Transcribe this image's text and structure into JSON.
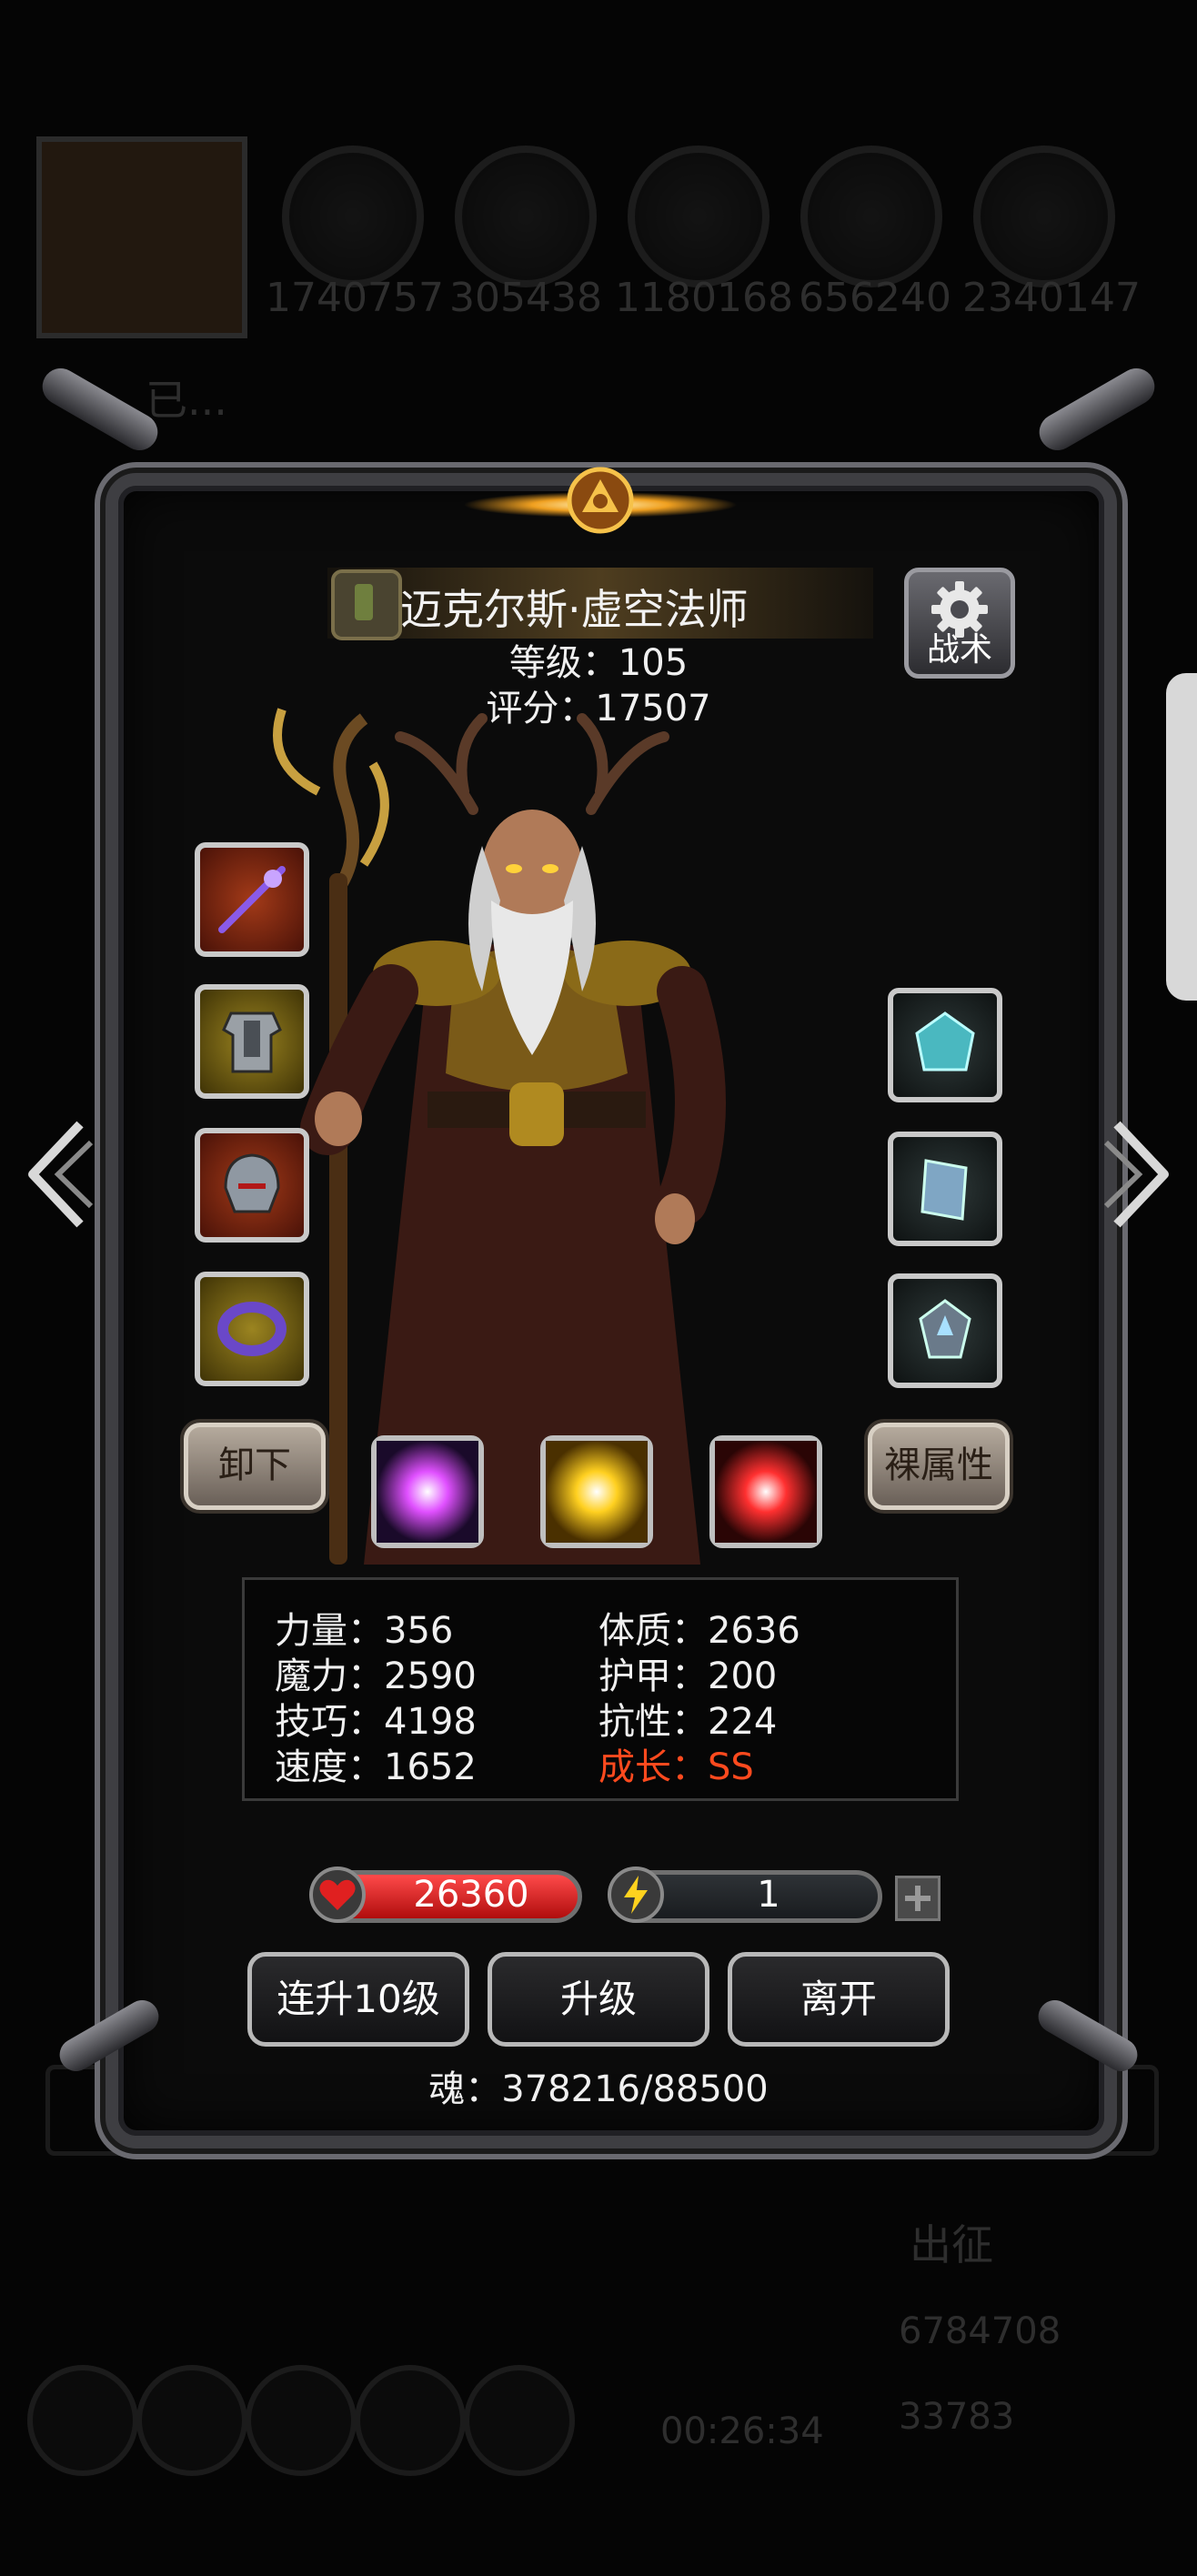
{
  "background": {
    "resources": [
      "1740757",
      "305438",
      "1180168",
      "656240",
      "2340147"
    ],
    "notice_text": "已...",
    "march_label": "出征",
    "gold": "6784708",
    "gems": "33783",
    "timer": "00:26:34"
  },
  "hero": {
    "name": "迈克尔斯·虚空法师",
    "level": "等级：105",
    "rating": "评分：17507"
  },
  "tactics_label": "战术",
  "buttons": {
    "unequip": "卸下",
    "base_attributes": "裸属性",
    "level_up_10": "连升10级",
    "level_up": "升级",
    "leave": "离开"
  },
  "stats": {
    "strength": "力量：356",
    "magic": "魔力：2590",
    "skill": "技巧：4198",
    "speed": "速度：1652",
    "constitution": "体质：2636",
    "armor": "护甲：200",
    "resistance": "抗性：224",
    "growth": "成长：SS"
  },
  "hp": "26360",
  "energy": "1",
  "soul": "魂：378216/88500",
  "colors": {
    "growth_text": "#ff4a1e",
    "hp_bar": "#d41818",
    "frame": "#3e3e42"
  },
  "icons": {
    "left_slots": [
      "staff-weapon-icon",
      "armor-icon",
      "helmet-icon",
      "ring-icon"
    ],
    "right_slots": [
      "crystal-gem-icon",
      "book-icon",
      "emblem-icon"
    ],
    "gems": [
      "purple-gem-icon",
      "gold-gem-icon",
      "red-gem-icon"
    ]
  }
}
